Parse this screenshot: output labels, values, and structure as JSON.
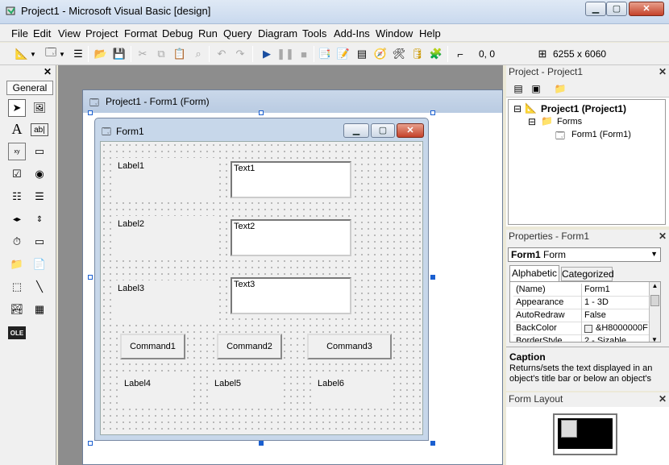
{
  "window": {
    "title": "Project1 - Microsoft Visual Basic [design]"
  },
  "menu": [
    "File",
    "Edit",
    "View",
    "Project",
    "Format",
    "Debug",
    "Run",
    "Query",
    "Diagram",
    "Tools",
    "Add-Ins",
    "Window",
    "Help"
  ],
  "toolbar": {
    "position": "0, 0",
    "size": "6255 x 6060"
  },
  "toolbox": {
    "tab": "General"
  },
  "designer": {
    "title": "Project1 - Form1 (Form)"
  },
  "form": {
    "title": "Form1",
    "labels": [
      "Label1",
      "Label2",
      "Label3",
      "Label4",
      "Label5",
      "Label6"
    ],
    "textboxes": [
      "Text1",
      "Text2",
      "Text3"
    ],
    "buttons": [
      "Command1",
      "Command2",
      "Command3"
    ]
  },
  "project": {
    "header": "Project - Project1",
    "root": "Project1 (Project1)",
    "folder": "Forms",
    "item": "Form1 (Form1)"
  },
  "properties": {
    "header": "Properties - Form1",
    "object_name": "Form1",
    "object_type": "Form",
    "tabs": [
      "Alphabetic",
      "Categorized"
    ],
    "rows": [
      {
        "name": "(Name)",
        "value": "Form1"
      },
      {
        "name": "Appearance",
        "value": "1 - 3D"
      },
      {
        "name": "AutoRedraw",
        "value": "False"
      },
      {
        "name": "BackColor",
        "value": "&H8000000F"
      },
      {
        "name": "BorderStyle",
        "value": "2 - Sizable"
      }
    ],
    "desc_title": "Caption",
    "desc_text": "Returns/sets the text displayed in an object's title bar or below an object's"
  },
  "layout": {
    "header": "Form Layout"
  }
}
